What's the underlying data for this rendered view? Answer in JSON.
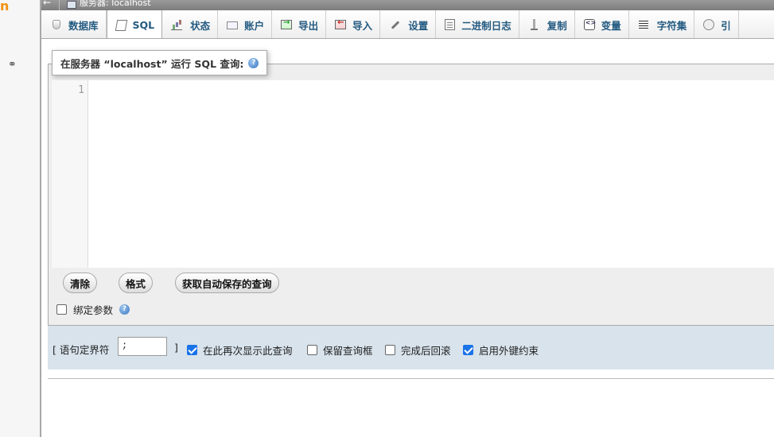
{
  "topbar": {
    "back_glyph": "←",
    "server_label": "服务器: localhost"
  },
  "nav": {
    "logo_fragment": "n",
    "link_glyph": "⚭"
  },
  "tabs": [
    {
      "id": "databases",
      "label": "数据库",
      "icon": "database-icon"
    },
    {
      "id": "sql",
      "label": "SQL",
      "icon": "sql-icon",
      "active": true
    },
    {
      "id": "status",
      "label": "状态",
      "icon": "status-chart-icon"
    },
    {
      "id": "accounts",
      "label": "账户",
      "icon": "user-accounts-icon"
    },
    {
      "id": "export",
      "label": "导出",
      "icon": "export-icon"
    },
    {
      "id": "import",
      "label": "导入",
      "icon": "import-icon"
    },
    {
      "id": "settings",
      "label": "设置",
      "icon": "wrench-icon"
    },
    {
      "id": "binlog",
      "label": "二进制日志",
      "icon": "binary-log-icon"
    },
    {
      "id": "replication",
      "label": "复制",
      "icon": "replication-icon"
    },
    {
      "id": "variables",
      "label": "变量",
      "icon": "variables-icon"
    },
    {
      "id": "charsets",
      "label": "字符集",
      "icon": "charset-icon"
    },
    {
      "id": "engines",
      "label": "引",
      "icon": "engine-icon"
    }
  ],
  "query": {
    "legend": "在服务器 “localhost” 运行 SQL 查询:",
    "help_glyph": "?",
    "line_numbers": [
      "1"
    ],
    "content": ""
  },
  "buttons": {
    "clear": "清除",
    "format": "格式",
    "get_autosaved": "获取自动保存的查询"
  },
  "bind_params": {
    "label": "绑定参数",
    "checked": false
  },
  "options": {
    "delimiter_open": "[ 语句定界符",
    "delimiter_value": ";",
    "delimiter_close": "]",
    "show_again_label": "在此再次显示此查询",
    "show_again_checked": true,
    "retain_box_label": "保留查询框",
    "retain_box_checked": false,
    "rollback_label": "完成后回滚",
    "rollback_checked": false,
    "fk_checks_label": "启用外键约束",
    "fk_checks_checked": true
  }
}
